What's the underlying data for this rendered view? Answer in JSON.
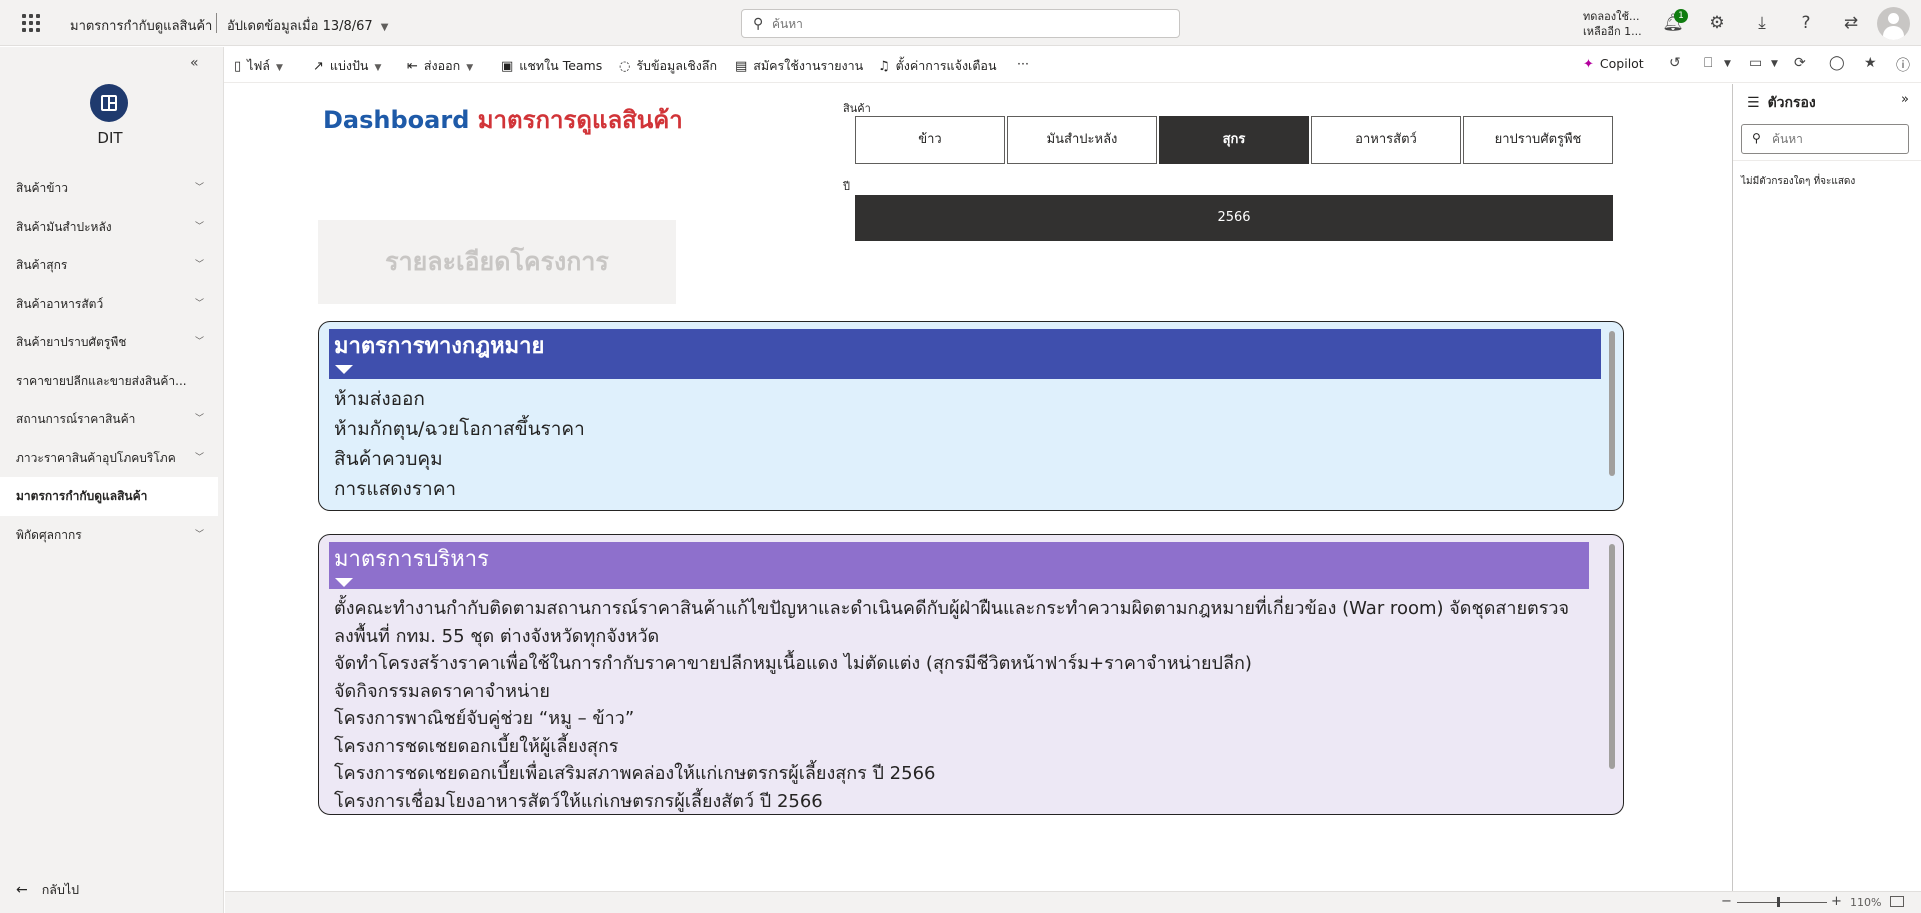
{
  "topbar": {
    "app_title": "มาตรการกำกับดูแลสินค้า",
    "updated": "อัปเดตข้อมูลเมื่อ 13/8/67",
    "search_placeholder": "ค้นหา",
    "trial_line1": "ทดลองใช้...",
    "trial_line2": "เหลืออีก 1...",
    "notification_count": "1"
  },
  "toolbar": {
    "items": [
      {
        "label": "ไฟล์",
        "icon": "file-icon"
      },
      {
        "label": "แบ่งปัน",
        "icon": "share-icon"
      },
      {
        "label": "ส่งออก",
        "icon": "export-icon"
      },
      {
        "label": "แชทใน Teams",
        "icon": "teams-icon"
      },
      {
        "label": "รับข้อมูลเชิงลึก",
        "icon": "lightbulb-icon"
      },
      {
        "label": "สมัครใช้งานรายงาน",
        "icon": "subscribe-icon"
      },
      {
        "label": "ตั้งค่าการแจ้งเตือน",
        "icon": "bell-icon"
      }
    ],
    "more": "···",
    "copilot": "Copilot"
  },
  "leftnav": {
    "workspace_name": "DIT",
    "items": [
      {
        "label": "สินค้าข้าว",
        "expandable": true
      },
      {
        "label": "สินค้ามันสำปะหลัง",
        "expandable": true
      },
      {
        "label": "สินค้าสุกร",
        "expandable": true
      },
      {
        "label": "สินค้าอาหารสัตว์",
        "expandable": true
      },
      {
        "label": "สินค้ายาปราบศัตรูพืช",
        "expandable": true
      },
      {
        "label": "ราคาขายปลีกและขายส่งสินค้า...",
        "expandable": false
      },
      {
        "label": "สถานการณ์ราคาสินค้า",
        "expandable": true
      },
      {
        "label": "ภาวะราคาสินค้าอุปโภคบริโภค",
        "expandable": true
      },
      {
        "label": "มาตรการกำกับดูแลสินค้า",
        "expandable": false,
        "active": true
      },
      {
        "label": "พิกัดศุลกากร",
        "expandable": true
      }
    ],
    "back_label": "กลับไป"
  },
  "dashboard": {
    "title_part1": "Dashboard",
    "title_part2": "มาตรการดูแลสินค้า",
    "product_slicer_label": "สินค้า",
    "products": [
      "ข้าว",
      "มันสำปะหลัง",
      "สุกร",
      "อาหารสัตว์",
      "ยาปราบศัตรูพืช"
    ],
    "selected_product": "สุกร",
    "year_slicer_label": "ปี",
    "selected_year": "2566",
    "detail_button": "รายละเอียดโครงการ",
    "legal_measures": {
      "title": "มาตรการทางกฎหมาย",
      "color": "#3f4fad",
      "items": [
        "ห้ามส่งออก",
        "ห้ามกักตุน/ฉวยโอกาสขึ้นราคา",
        "สินค้าควบคุม",
        "การแสดงราคา"
      ]
    },
    "admin_measures": {
      "title": "มาตรการบริหาร",
      "color": "#8e70cc",
      "items": [
        "ตั้งคณะทำงานกำกับติดตามสถานการณ์ราคาสินค้าแก้ไขปัญหาและดำเนินคดีกับผู้ฝ่าฝืนและกระทำความผิดตามกฎหมายที่เกี่ยวข้อง (War room) จัดชุดสายตรวจลงพื้นที่ กทม. 55 ชุด ต่างจังหวัดทุกจังหวัด",
        "จัดทำโครงสร้างราคาเพื่อใช้ในการกำกับราคาขายปลีกหมูเนื้อแดง ไม่ตัดแต่ง (สุกรมีชีวิตหน้าฟาร์ม+ราคาจำหน่ายปลีก)",
        "จัดกิจกรรมลดราคาจำหน่าย",
        "โครงการพาณิชย์จับคู่ช่วย “หมู – ข้าว”",
        "โครงการชดเชยดอกเบี้ยให้ผู้เลี้ยงสุกร",
        "โครงการชดเชยดอกเบี้ยเพื่อเสริมสภาพคล่องให้แก่เกษตรกรผู้เลี้ยงสุกร ปี 2566",
        "โครงการเชื่อมโยงอาหารสัตว์ให้แก่เกษตรกรผู้เลี้ยงสัตว์ ปี 2566"
      ]
    }
  },
  "filterpane": {
    "title": "ตัวกรอง",
    "search_placeholder": "ค้นหา",
    "empty_text": "ไม่มีตัวกรองใดๆ ที่จะแสดง"
  },
  "statusbar": {
    "zoom_level": "110%",
    "zoom_fraction": 0.45
  }
}
